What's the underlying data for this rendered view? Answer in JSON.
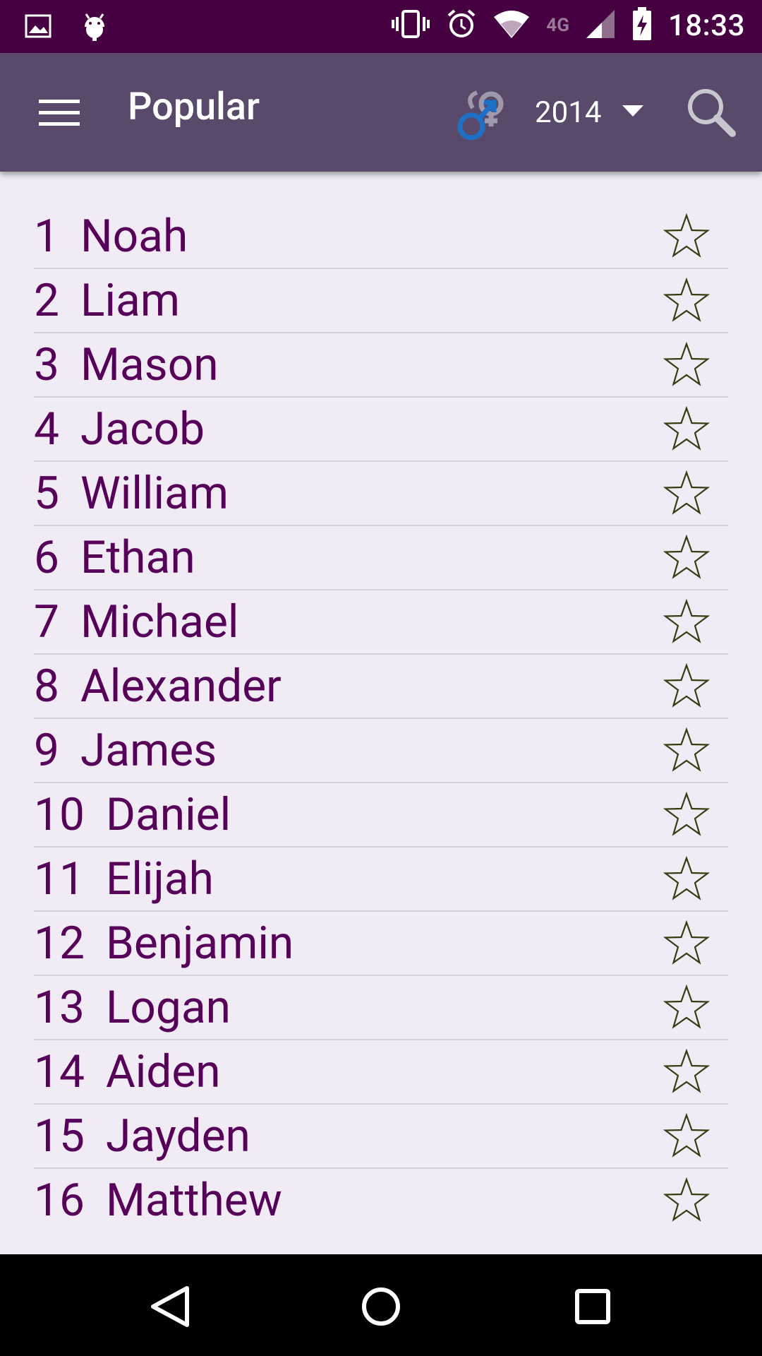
{
  "status_bar": {
    "time": "18:33",
    "network": "4G",
    "icons": [
      "image-icon",
      "android-icon",
      "vibrate-icon",
      "alarm-icon",
      "wifi-icon",
      "signal-icon",
      "battery-charging-icon"
    ]
  },
  "app_bar": {
    "title": "Popular",
    "year": "2014",
    "icons": {
      "menu": "hamburger-menu-icon",
      "gender": "gender-toggle-icon",
      "dropdown": "caret-down-icon",
      "search": "search-icon"
    }
  },
  "names": [
    {
      "rank": "1",
      "name": "Noah"
    },
    {
      "rank": "2",
      "name": "Liam"
    },
    {
      "rank": "3",
      "name": "Mason"
    },
    {
      "rank": "4",
      "name": "Jacob"
    },
    {
      "rank": "5",
      "name": "William"
    },
    {
      "rank": "6",
      "name": "Ethan"
    },
    {
      "rank": "7",
      "name": "Michael"
    },
    {
      "rank": "8",
      "name": "Alexander"
    },
    {
      "rank": "9",
      "name": "James"
    },
    {
      "rank": "10",
      "name": "Daniel"
    },
    {
      "rank": "11",
      "name": "Elijah"
    },
    {
      "rank": "12",
      "name": "Benjamin"
    },
    {
      "rank": "13",
      "name": "Logan"
    },
    {
      "rank": "14",
      "name": "Aiden"
    },
    {
      "rank": "15",
      "name": "Jayden"
    },
    {
      "rank": "16",
      "name": "Matthew"
    }
  ],
  "nav_bar": {
    "icons": [
      "back-icon",
      "home-icon",
      "recents-icon"
    ]
  },
  "colors": {
    "status_bar": "#460042",
    "app_bar": "#594a6b",
    "background": "#f1ebf5",
    "name_text": "#560059",
    "divider": "#d6cfdb",
    "star_outline": "#3a3a10",
    "male_icon": "#1e6fc6"
  }
}
